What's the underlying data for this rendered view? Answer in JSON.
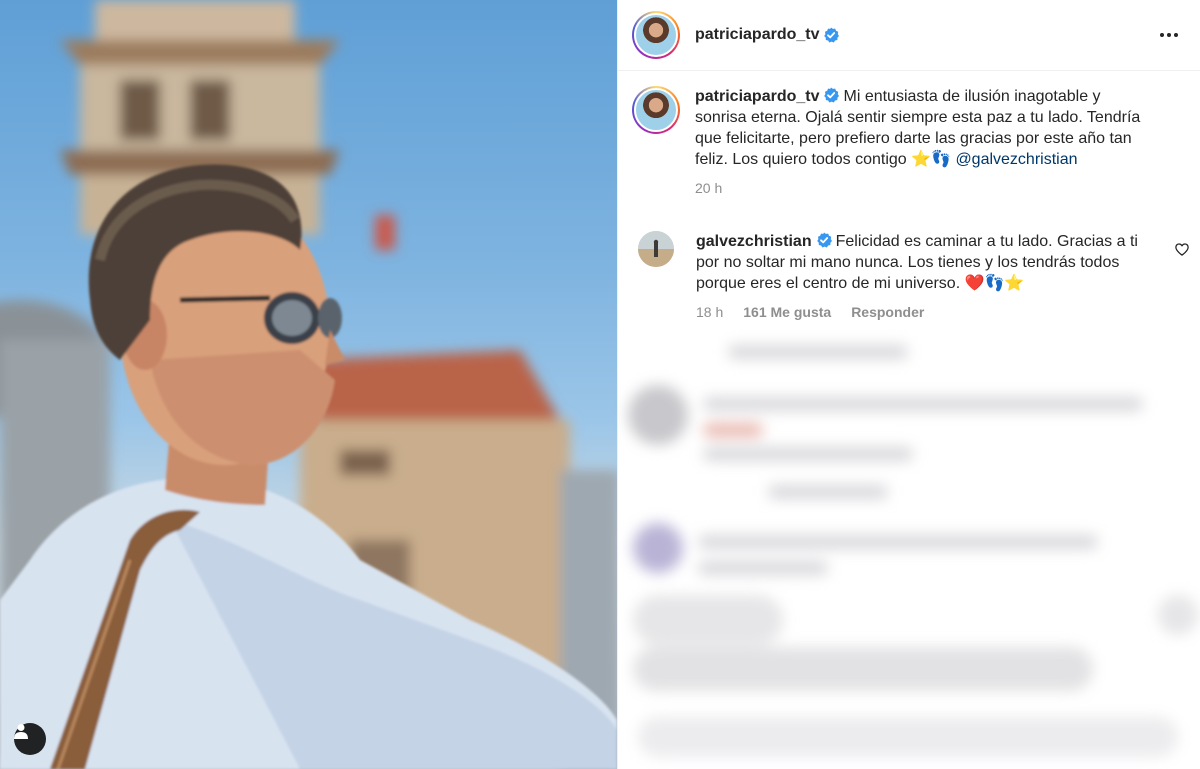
{
  "post": {
    "author": "patriciapardo_tv",
    "verified": true
  },
  "caption": {
    "username": "patriciapardo_tv",
    "text": "Mi entusiasta de ilusión inagotable y sonrisa eterna. Ojalá sentir siempre esta paz a tu lado. Tendría que felicitarte, pero prefiero darte las gracias por este año tan feliz. Los quiero todos contigo ⭐👣",
    "mention": "@galvezchristian",
    "time": "20 h"
  },
  "reply": {
    "username": "galvezchristian",
    "text": "Felicidad es caminar a tu lado. Gracias a ti por no soltar mi mano nunca. Los tienes y los tendrás todos porque eres el centro de mi universo. ❤️👣⭐",
    "time": "18 h",
    "likes": "161 Me gusta",
    "reply_label": "Responder"
  },
  "icons": {
    "more": "more-options-icon",
    "verified": "verified-badge-icon",
    "like": "heart-outline-icon",
    "user_tag": "person-tag-icon"
  },
  "colors": {
    "verified": "#3897f0",
    "mention": "#00376b",
    "meta": "#8e8e8e"
  }
}
